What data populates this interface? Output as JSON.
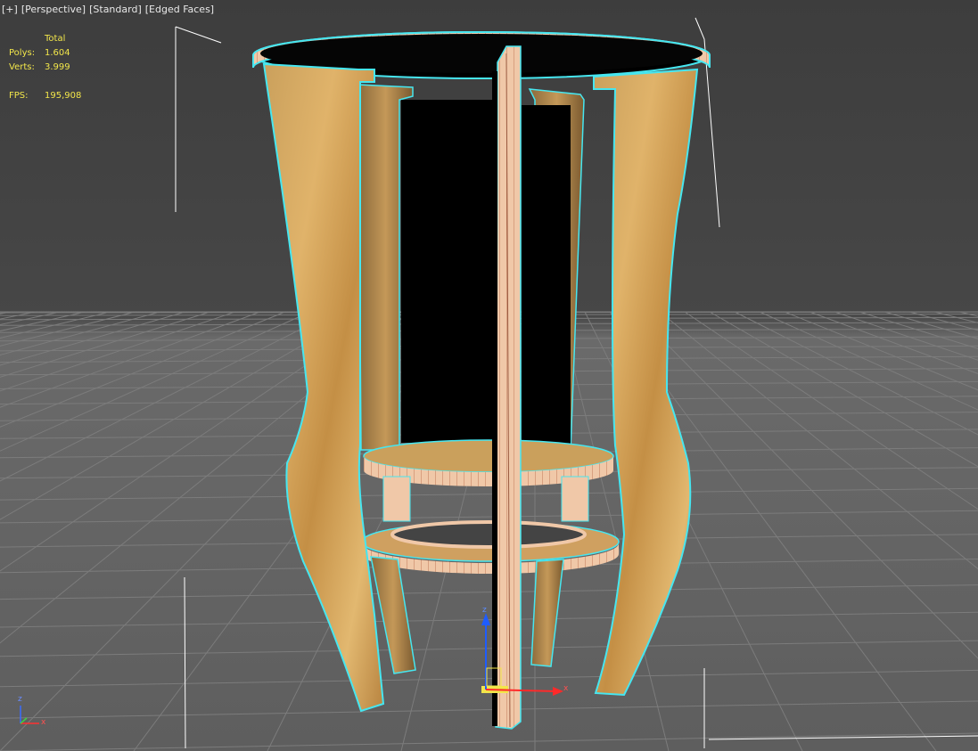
{
  "viewport": {
    "labels": [
      "[+]",
      "[Perspective]",
      "[Standard]",
      "[Edged Faces]"
    ]
  },
  "stats": {
    "total_label": "Total",
    "polys_label": "Polys:",
    "polys_value": "1.604",
    "verts_label": "Verts:",
    "verts_value": "3.999",
    "fps_label": "FPS:",
    "fps_value": "195,908"
  },
  "gizmo": {
    "x": "x",
    "z": "z"
  },
  "axis_tripod": {
    "x": "x",
    "z": "z"
  },
  "colors": {
    "background": "#444444",
    "grid": "#7a7a7a",
    "stats_text": "#f2e64a",
    "selection": "#46e6f0",
    "wood": "#d8a55a"
  }
}
